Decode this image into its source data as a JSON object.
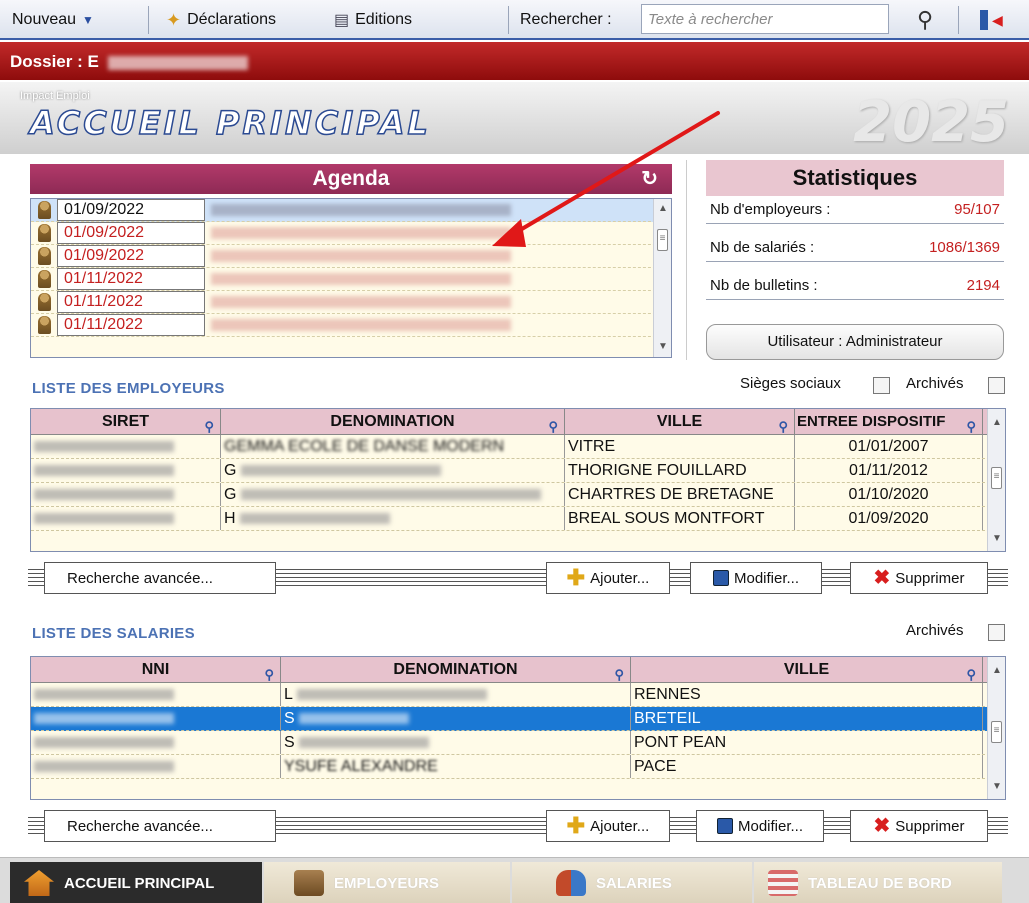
{
  "toolbar": {
    "nouveau": "Nouveau",
    "declarations": "Déclarations",
    "editions": "Editions",
    "rechercher": "Rechercher :",
    "search_placeholder": "Texte à rechercher"
  },
  "dossier": {
    "label": "Dossier : E"
  },
  "banner": {
    "subtitle": "Impact Emploi",
    "title": "ACCUEIL PRINCIPAL",
    "year": "2025"
  },
  "agenda": {
    "title": "Agenda",
    "rows": [
      {
        "date": "01/09/2022"
      },
      {
        "date": "01/09/2022"
      },
      {
        "date": "01/09/2022"
      },
      {
        "date": "01/11/2022"
      },
      {
        "date": "01/11/2022"
      },
      {
        "date": "01/11/2022"
      }
    ]
  },
  "stats": {
    "title": "Statistiques",
    "rows": [
      {
        "label": "Nb d'employeurs :",
        "value": "95/107"
      },
      {
        "label": "Nb de salariés :",
        "value": "1086/1369"
      },
      {
        "label": "Nb de bulletins :",
        "value": "2194"
      }
    ],
    "user": "Utilisateur : Administrateur"
  },
  "employeurs": {
    "title": "LISTE DES EMPLOYEURS",
    "sieges": "Sièges sociaux",
    "archives": "Archivés",
    "headers": [
      "SIRET",
      "DENOMINATION",
      "VILLE",
      "ENTREE DISPOSITIF"
    ],
    "rows": [
      {
        "denom": "GEMMA ECOLE DE DANSE MODERN",
        "ville": "VITRE",
        "date": "01/01/2007"
      },
      {
        "denom": "G",
        "ville": "THORIGNE FOUILLARD",
        "date": "01/11/2012"
      },
      {
        "denom": "G",
        "ville": "CHARTRES DE BRETAGNE",
        "date": "01/10/2020"
      },
      {
        "denom": "H",
        "ville": "BREAL SOUS MONTFORT",
        "date": "01/09/2020"
      }
    ]
  },
  "salaries": {
    "title": "LISTE DES SALARIES",
    "archives": "Archivés",
    "headers": [
      "NNI",
      "DENOMINATION",
      "VILLE"
    ],
    "rows": [
      {
        "denom": "L",
        "ville": "RENNES"
      },
      {
        "denom": "S",
        "ville": "BRETEIL"
      },
      {
        "denom": "S",
        "ville": "PONT PEAN"
      },
      {
        "denom": "YSUFE ALEXANDRE",
        "ville": "PACE"
      }
    ]
  },
  "buttons": {
    "recherche": "Recherche avancée...",
    "ajouter": "Ajouter...",
    "modifier": "Modifier...",
    "supprimer": "Supprimer"
  },
  "tabs": [
    "ACCUEIL PRINCIPAL",
    "EMPLOYEURS",
    "SALARIES",
    "TABLEAU DE BORD"
  ],
  "colors": {
    "accent_red": "#c42020",
    "header_pink": "#e7c2cd",
    "selection_blue": "#1a78d4"
  }
}
